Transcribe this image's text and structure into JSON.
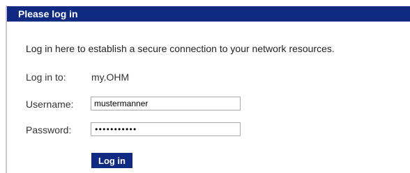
{
  "header": {
    "title": "Please log in"
  },
  "intro": {
    "text": "Log in here to establish a secure connection to your network resources."
  },
  "form": {
    "login_to_label": "Log in to:",
    "login_to_value": "my.OHM",
    "username_label": "Username:",
    "username_value": "mustermanner",
    "password_label": "Password:",
    "password_value": "•••••••••••",
    "submit_label": "Log in"
  },
  "colors": {
    "header_bg": "#0f2a80",
    "button_bg": "#0f2a80",
    "header_text": "#ffffff"
  }
}
